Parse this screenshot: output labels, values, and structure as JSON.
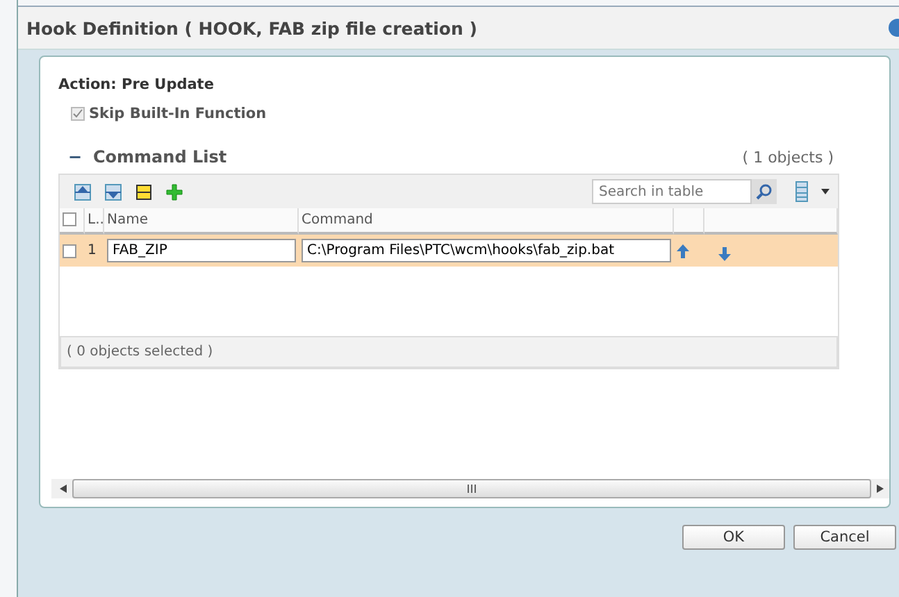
{
  "window": {
    "title": "Hook Definition ( HOOK, FAB zip file creation )"
  },
  "action": "Action: Pre Update",
  "skip_builtin": {
    "label": "Skip Built-In Function",
    "checked": true,
    "disabled": true
  },
  "command_list": {
    "collapse_sign": "−",
    "title": "Command List",
    "count": "( 1 objects )",
    "search": {
      "placeholder": "Search in table"
    },
    "select_all_checked": false,
    "columns": [
      "L..",
      "Name",
      "Command"
    ],
    "rows": [
      {
        "checked": false,
        "line": "1",
        "name": "FAB_ZIP",
        "command": "C:\\Program Files\\PTC\\wcm\\hooks\\fab_zip.bat"
      }
    ],
    "status": "( 0 objects selected )"
  },
  "buttons": [
    "OK",
    "Cancel"
  ]
}
